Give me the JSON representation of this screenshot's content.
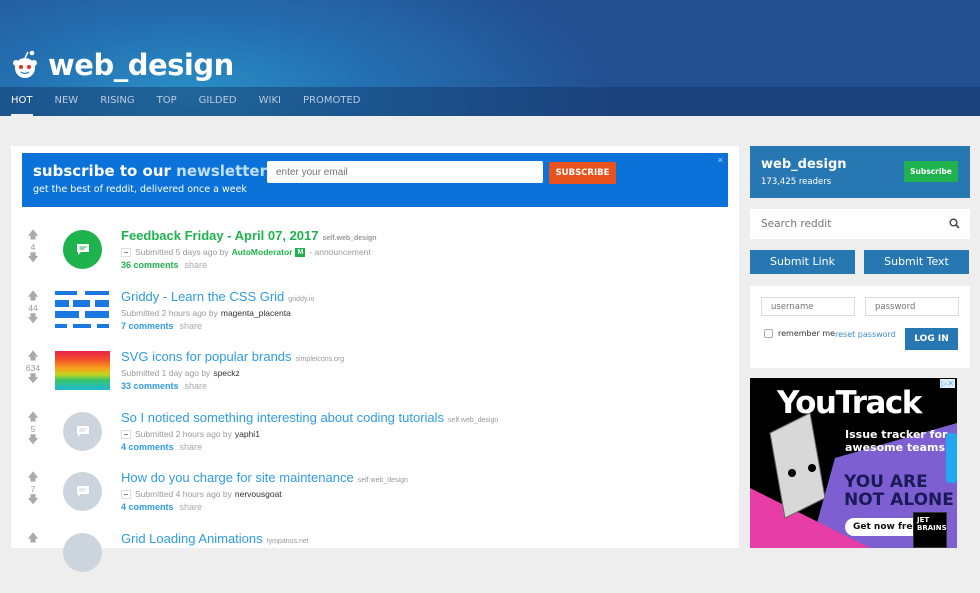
{
  "header": {
    "title": "web_design",
    "nav": [
      {
        "label": "HOT",
        "active": true
      },
      {
        "label": "NEW"
      },
      {
        "label": "RISING"
      },
      {
        "label": "TOP"
      },
      {
        "label": "GILDED"
      },
      {
        "label": "WIKI"
      },
      {
        "label": "PROMOTED"
      }
    ]
  },
  "newsletter": {
    "title_part1": "subscribe to our ",
    "title_part2": "newsletter",
    "subtitle": "get the best of reddit, delivered once a week",
    "email_placeholder": "enter your email",
    "button": "SUBSCRIBE",
    "close": "×"
  },
  "posts": [
    {
      "score": "4",
      "title": "Feedback Friday - April 07, 2017",
      "domain": "self.web_design",
      "submitted": "Submitted 5 days ago by",
      "author": "AutoModerator",
      "badge": "M",
      "suffix": "- announcement",
      "comments": "36 comments",
      "share": "share"
    },
    {
      "score": "44",
      "title": "Griddy - Learn the CSS Grid",
      "domain": "griddy.io",
      "submitted": "Submitted 2 hours ago by",
      "author": "magenta_placenta",
      "comments": "7 comments",
      "share": "share"
    },
    {
      "score": "634",
      "title": "SVG icons for popular brands",
      "domain": "simpleicons.org",
      "submitted": "Submitted 1 day ago by",
      "author": "speckz",
      "comments": "33 comments",
      "share": "share"
    },
    {
      "score": "5",
      "title": "So I noticed something interesting about coding tutorials",
      "domain": "self.web_design",
      "submitted": "Submitted 2 hours ago by",
      "author": "yaphi1",
      "comments": "4 comments",
      "share": "share"
    },
    {
      "score": "7",
      "title": "How do you charge for site maintenance",
      "domain": "self.web_design",
      "submitted": "Submitted 4 hours ago by",
      "author": "nervousgoat",
      "comments": "4 comments",
      "share": "share"
    },
    {
      "score": "",
      "title": "Grid Loading Animations",
      "domain": "tympanus.net"
    }
  ],
  "sidebar": {
    "subreddit": "web_design",
    "readers": "173,425 readers",
    "subscribe": "Subscribe",
    "search_placeholder": "Search reddit",
    "submit_link": "Submit Link",
    "submit_text": "Submit Text",
    "username_placeholder": "username",
    "password_placeholder": "password",
    "remember_me": "remember me",
    "reset_password": "reset password",
    "login": "LOG IN"
  },
  "ad": {
    "brand": "YouTrack",
    "tagline1": "Issue tracker for",
    "tagline2": "awesome teams",
    "slogan1": "YOU ARE",
    "slogan2": "NOT ALONE",
    "cta": "Get now free",
    "vendor1": "JET",
    "vendor2": "BRAINS"
  },
  "colors": {
    "accent": "#2778b2",
    "link": "#2f9ce2",
    "mod_green": "#1fb34d",
    "newsletter_bg": "#0a72d8",
    "subscribe_orange": "#e8531d"
  }
}
